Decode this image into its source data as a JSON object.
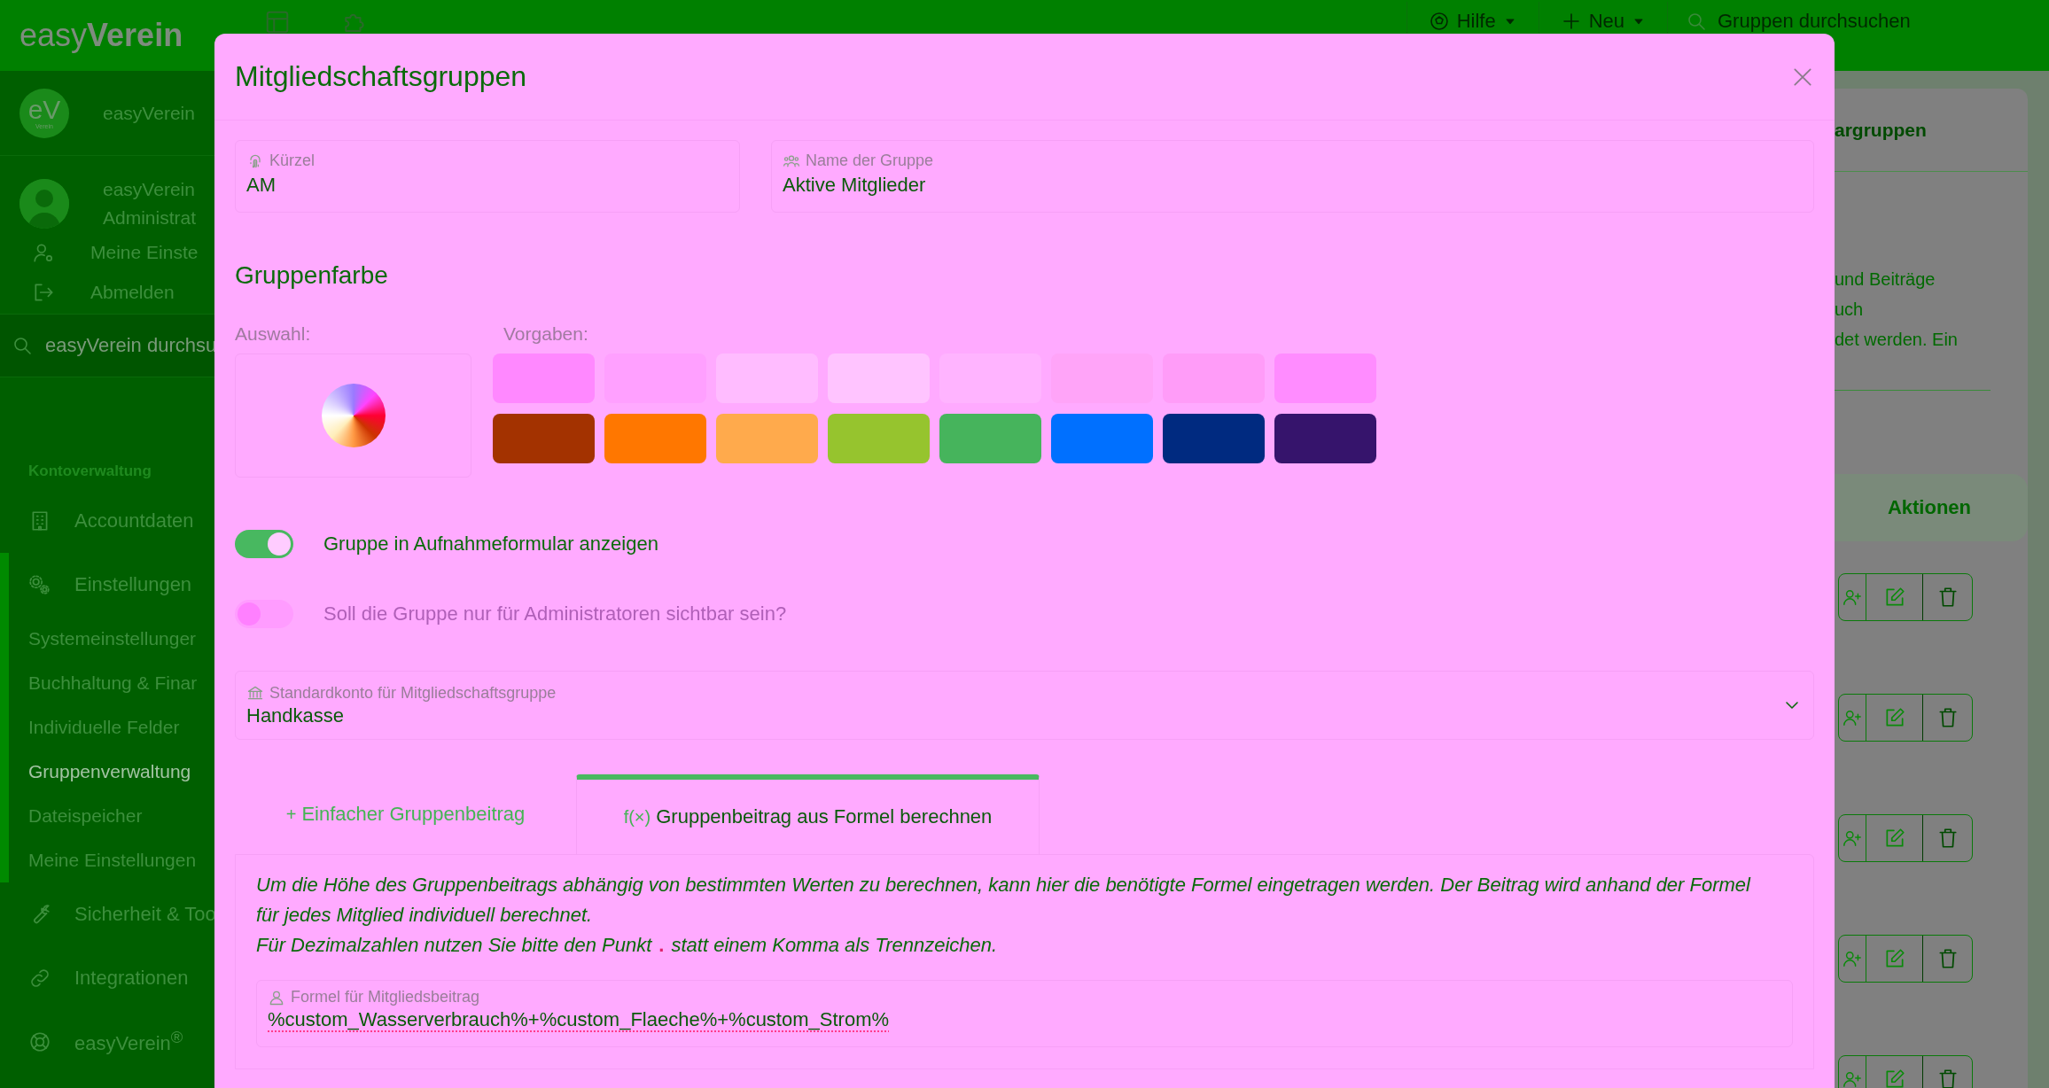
{
  "topbar": {
    "logo_light": "easy",
    "logo_bold": "Verein",
    "help": "Hilfe",
    "new": "Neu",
    "search_placeholder": "Gruppen durchsuchen"
  },
  "sidebar": {
    "account_logo": "eV",
    "account_logo_sub": "Verein",
    "account_name": "easyVerein",
    "user_name": "easyVerein",
    "user_role": "Administrat",
    "links": [
      {
        "label": "Meine Einste"
      },
      {
        "label": "Abmelden"
      }
    ],
    "search_placeholder": "easyVerein durchsu",
    "section": "Kontoverwaltung",
    "items": [
      {
        "label": "Accountdaten",
        "expanded": false
      },
      {
        "label": "Einstellungen",
        "expanded": true,
        "children": [
          {
            "label": "Systemeinstellunger",
            "selected": false
          },
          {
            "label": "Buchhaltung & Finar",
            "selected": false
          },
          {
            "label": "Individuelle Felder",
            "selected": false
          },
          {
            "label": "Gruppenverwaltung",
            "selected": true
          },
          {
            "label": "Dateispeicher",
            "selected": false
          },
          {
            "label": "Meine Einstellungen",
            "selected": false
          }
        ]
      },
      {
        "label": "Sicherheit & Too",
        "expanded": false
      },
      {
        "label": "Integrationen",
        "expanded": false
      },
      {
        "label": "easyVerein$^{®}$",
        "expanded": false
      }
    ]
  },
  "background_card": {
    "tab_label": "argruppen",
    "description_lines": [
      "und Beiträge",
      "uch",
      "det werden. Ein"
    ],
    "table_header": "Aktionen"
  },
  "dialog": {
    "title": "Mitgliedschaftsgruppen",
    "fields": [
      {
        "label": "Kürzel",
        "value": "AM"
      },
      {
        "label": "Name der Gruppe",
        "value": "Aktive Mitglieder"
      }
    ],
    "color_section": {
      "heading": "Gruppenfarbe",
      "picker_label": "Auswahl:",
      "presets_label": "Vorgaben:",
      "presets": [
        {
          "color": "#ff88ff"
        },
        {
          "color": "#ffa0ff"
        },
        {
          "color": "#ffbcff"
        },
        {
          "color": "#ffc4ff"
        },
        {
          "color": "#ffb4ff"
        },
        {
          "color": "#ffa4f8"
        },
        {
          "color": "#ff9cf8"
        },
        {
          "color": "#ff8cff"
        },
        {
          "color": "#a33200"
        },
        {
          "color": "#ff7700"
        },
        {
          "color": "#ffaa4c"
        },
        {
          "color": "#96c42e"
        },
        {
          "color": "#46b45c"
        },
        {
          "color": "#0070ff"
        },
        {
          "color": "#002a80"
        },
        {
          "color": "#36146c"
        }
      ]
    },
    "toggles": [
      {
        "label": "Gruppe in Aufnahmeformular anzeigen",
        "on": true,
        "disabled": false
      },
      {
        "label": "Soll die Gruppe nur für Administratoren sichtbar sein?",
        "on": false,
        "disabled": true
      }
    ],
    "select": {
      "label": "Standardkonto für Mitgliedschaftsgruppe",
      "value": "Handkasse"
    },
    "fee_tabs": [
      {
        "symbol": "+",
        "label": "Einfacher Gruppenbeitrag",
        "selected": false
      },
      {
        "symbol": "f(×)",
        "label": "Gruppenbeitrag aus Formel berechnen",
        "selected": true
      }
    ],
    "formula_panel": {
      "paragraph": "Um die Höhe des Gruppenbeitrags abhängig von bestimmten Werten zu berechnen, kann hier die benötigte Formel eingetragen werden. Der Beitrag wird anhand der Formel für jedes Mitglied individuell berechnet.",
      "hint": {
        "before": "Für Dezimalzahlen nutzen Sie bitte den Punkt",
        "code": ".",
        "after": "statt einem Komma als Trennzeichen."
      },
      "field": {
        "label": "Formel für Mitgliedsbeitrag",
        "value": "%custom_Wasserverbrauch%+%custom_Flaeche%+%custom_Strom%"
      }
    }
  }
}
